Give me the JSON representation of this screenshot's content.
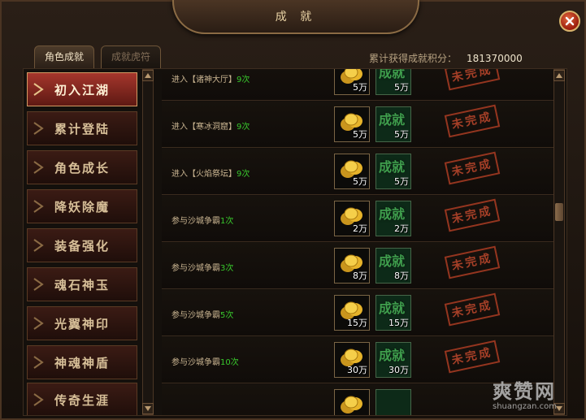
{
  "window": {
    "title": "成 就",
    "close_icon": "close-icon"
  },
  "tabs": [
    {
      "label": "角色成就",
      "active": true
    },
    {
      "label": "成就虎符",
      "active": false
    }
  ],
  "score": {
    "label": "累计获得成就积分：",
    "value": "181370000"
  },
  "categories": [
    {
      "label": "初入江湖",
      "active": true
    },
    {
      "label": "累计登陆",
      "active": false
    },
    {
      "label": "角色成长",
      "active": false
    },
    {
      "label": "降妖除魔",
      "active": false
    },
    {
      "label": "装备强化",
      "active": false
    },
    {
      "label": "魂石神玉",
      "active": false
    },
    {
      "label": "光翼神印",
      "active": false
    },
    {
      "label": "神魂神盾",
      "active": false
    },
    {
      "label": "传奇生涯",
      "active": false
    }
  ],
  "achievements": [
    {
      "text": "进入【诸神大厅】",
      "count": "9次",
      "coin_qty": "5万",
      "ach_label": "成就",
      "ach_qty": "5万",
      "status": "未完成"
    },
    {
      "text": "进入【寒冰洞窟】",
      "count": "9次",
      "coin_qty": "5万",
      "ach_label": "成就",
      "ach_qty": "5万",
      "status": "未完成"
    },
    {
      "text": "进入【火焰祭坛】",
      "count": "9次",
      "coin_qty": "5万",
      "ach_label": "成就",
      "ach_qty": "5万",
      "status": "未完成"
    },
    {
      "text": "参与沙城争霸",
      "count": "1次",
      "coin_qty": "2万",
      "ach_label": "成就",
      "ach_qty": "2万",
      "status": "未完成"
    },
    {
      "text": "参与沙城争霸",
      "count": "3次",
      "coin_qty": "8万",
      "ach_label": "成就",
      "ach_qty": "8万",
      "status": "未完成"
    },
    {
      "text": "参与沙城争霸",
      "count": "5次",
      "coin_qty": "15万",
      "ach_label": "成就",
      "ach_qty": "15万",
      "status": "未完成"
    },
    {
      "text": "参与沙城争霸",
      "count": "10次",
      "coin_qty": "30万",
      "ach_label": "成就",
      "ach_qty": "30万",
      "status": "未完成"
    },
    {
      "text": "",
      "count": "",
      "coin_qty": "",
      "ach_label": "",
      "ach_qty": "",
      "status": ""
    }
  ],
  "watermark": {
    "big": "爽赞网",
    "small": "shuangzan.com"
  },
  "colors": {
    "accent": "#a5362c",
    "green_count": "#38c82c",
    "stamp": "#b5452b"
  }
}
